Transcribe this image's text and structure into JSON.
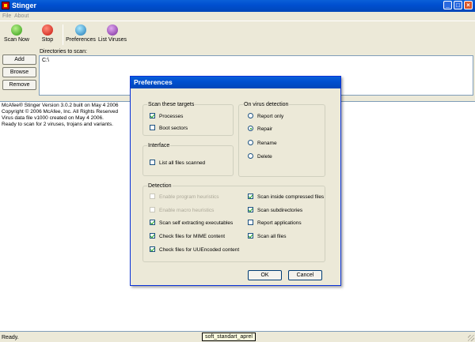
{
  "window": {
    "title": "Stinger",
    "min_glyph": "_",
    "max_glyph": "□",
    "close_glyph": "×"
  },
  "menu": [
    "File",
    "About"
  ],
  "toolbar": {
    "buttons": [
      {
        "label": "Scan Now",
        "icon": "scan-icon"
      },
      {
        "label": "Stop",
        "icon": "stop-icon"
      },
      {
        "label": "Preferences",
        "icon": "preferences-icon"
      },
      {
        "label": "List Viruses",
        "icon": "list-viruses-icon"
      }
    ]
  },
  "side_buttons": {
    "add": "Add",
    "browse": "Browse",
    "remove": "Remove"
  },
  "directories": {
    "label": "Directories to scan:",
    "items": [
      "C:\\"
    ]
  },
  "log": {
    "lines": [
      "McAfee® Stinger Version 3.0.2 built on May  4 2006",
      "Copyright © 2006 McAfee, Inc. All Rights Reserved",
      "Virus data file v1000 created on May 4 2006.",
      "Ready to scan for 2 viruses, trojans and variants."
    ]
  },
  "status": {
    "text": "Ready.",
    "tooltip": "soft_standart_aprel"
  },
  "preferences": {
    "title": "Preferences",
    "scan_targets": {
      "label": "Scan these targets",
      "options": [
        {
          "label": "Processes",
          "checked": true
        },
        {
          "label": "Boot sectors",
          "checked": false
        }
      ]
    },
    "interface": {
      "label": "Interface",
      "options": [
        {
          "label": "List all files scanned",
          "checked": false
        }
      ]
    },
    "on_virus_detection": {
      "label": "On virus detection",
      "options": [
        {
          "label": "Report only",
          "selected": false
        },
        {
          "label": "Repair",
          "selected": true
        },
        {
          "label": "Rename",
          "selected": false
        },
        {
          "label": "Delete",
          "selected": false
        }
      ]
    },
    "detection": {
      "label": "Detection",
      "left": [
        {
          "label": "Enable program heuristics",
          "checked": false,
          "enabled": false
        },
        {
          "label": "Enable macro heuristics",
          "checked": false,
          "enabled": false
        },
        {
          "label": "Scan self extracting executables",
          "checked": true,
          "enabled": true
        },
        {
          "label": "Check files for MIME content",
          "checked": true,
          "enabled": true
        },
        {
          "label": "Check files for UUEncoded content",
          "checked": true,
          "enabled": true
        }
      ],
      "right": [
        {
          "label": "Scan inside compressed files",
          "checked": true,
          "enabled": true
        },
        {
          "label": "Scan subdirectories",
          "checked": true,
          "enabled": true
        },
        {
          "label": "Report applications",
          "checked": false,
          "enabled": true
        },
        {
          "label": "Scan all files",
          "checked": true,
          "enabled": true
        }
      ]
    },
    "ok_label": "OK",
    "cancel_label": "Cancel"
  }
}
